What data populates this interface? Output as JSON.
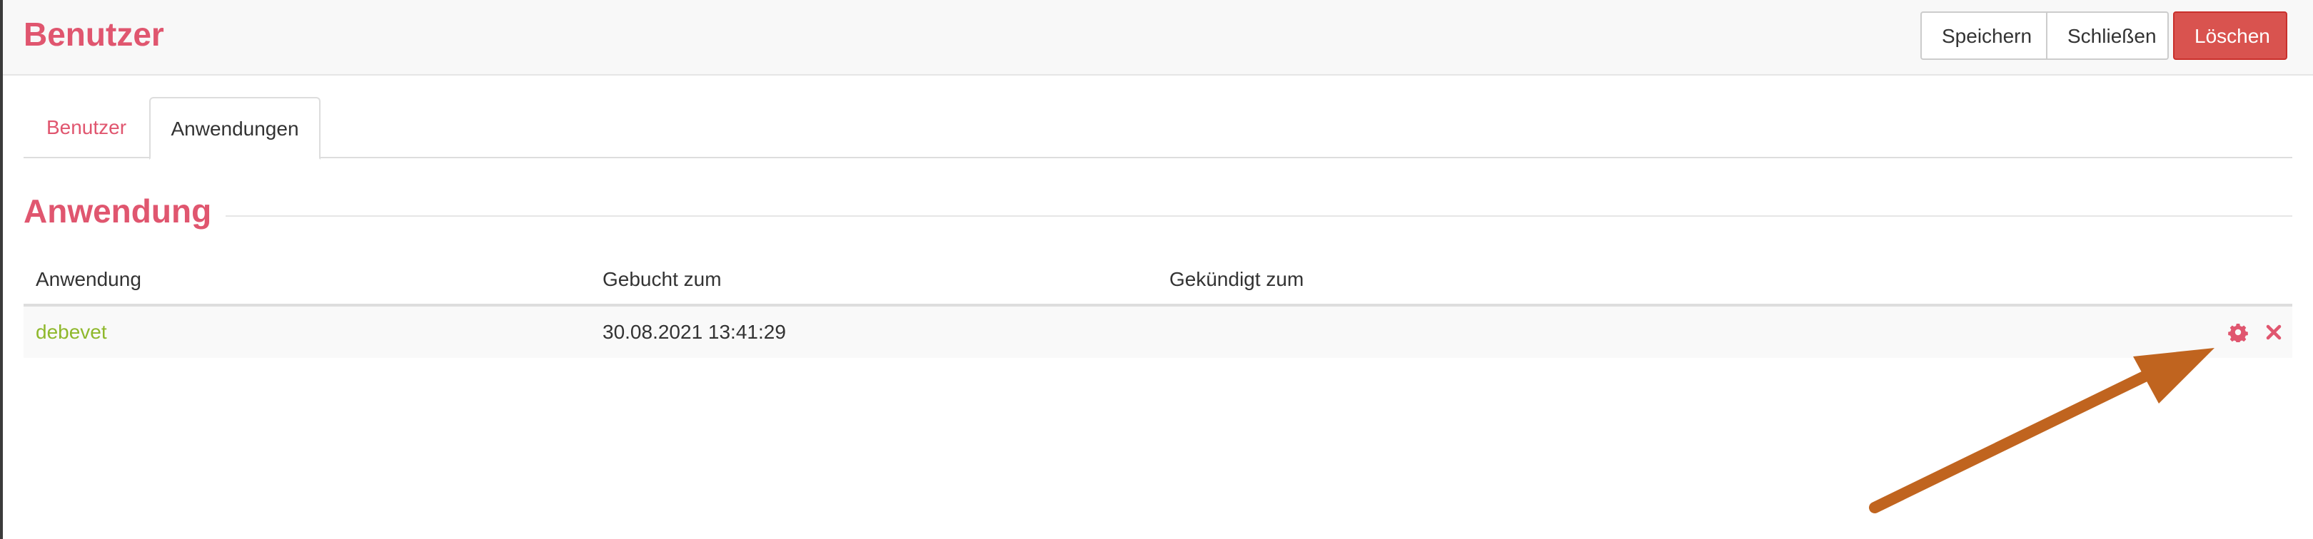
{
  "header": {
    "title": "Benutzer",
    "buttons": {
      "save": "Speichern",
      "close": "Schließen",
      "delete": "Löschen"
    }
  },
  "tabs": [
    {
      "label": "Benutzer",
      "active": false
    },
    {
      "label": "Anwendungen",
      "active": true
    }
  ],
  "section": {
    "title": "Anwendung"
  },
  "table": {
    "columns": [
      "Anwendung",
      "Gebucht zum",
      "Gekündigt zum"
    ],
    "rows": [
      {
        "application": "debevet",
        "booked": "30.08.2021 13:41:29",
        "cancelled": "",
        "actions": [
          "gear-icon",
          "close-icon"
        ]
      }
    ]
  },
  "colors": {
    "accent": "#e0566f",
    "danger": "#d9534f",
    "link_green": "#8fb82c",
    "annotation_arrow": "#c0641f"
  }
}
